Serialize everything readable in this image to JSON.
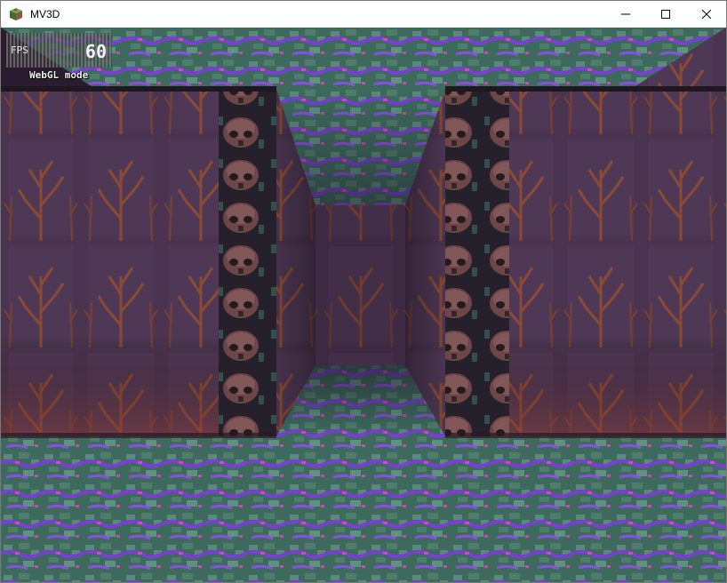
{
  "window": {
    "title": "MV3D",
    "controls": {
      "minimize": "minimize",
      "maximize": "maximize",
      "close": "close"
    }
  },
  "hud": {
    "fps_label": "FPS",
    "fps_value": "60",
    "render_mode": "WebGL mode"
  },
  "scene": {
    "description_type": "first-person dungeon corridor",
    "palette": {
      "ceiling_floor_base": "#3c6a5c",
      "ceiling_floor_accent_purple": "#7b3fd6",
      "ceiling_floor_accent_pink": "#d04ab8",
      "wall_base": "#4a3450",
      "wall_roots": "#8a4a34",
      "pillar_base": "#2a2430",
      "pillar_skull": "#8a5a58"
    }
  }
}
